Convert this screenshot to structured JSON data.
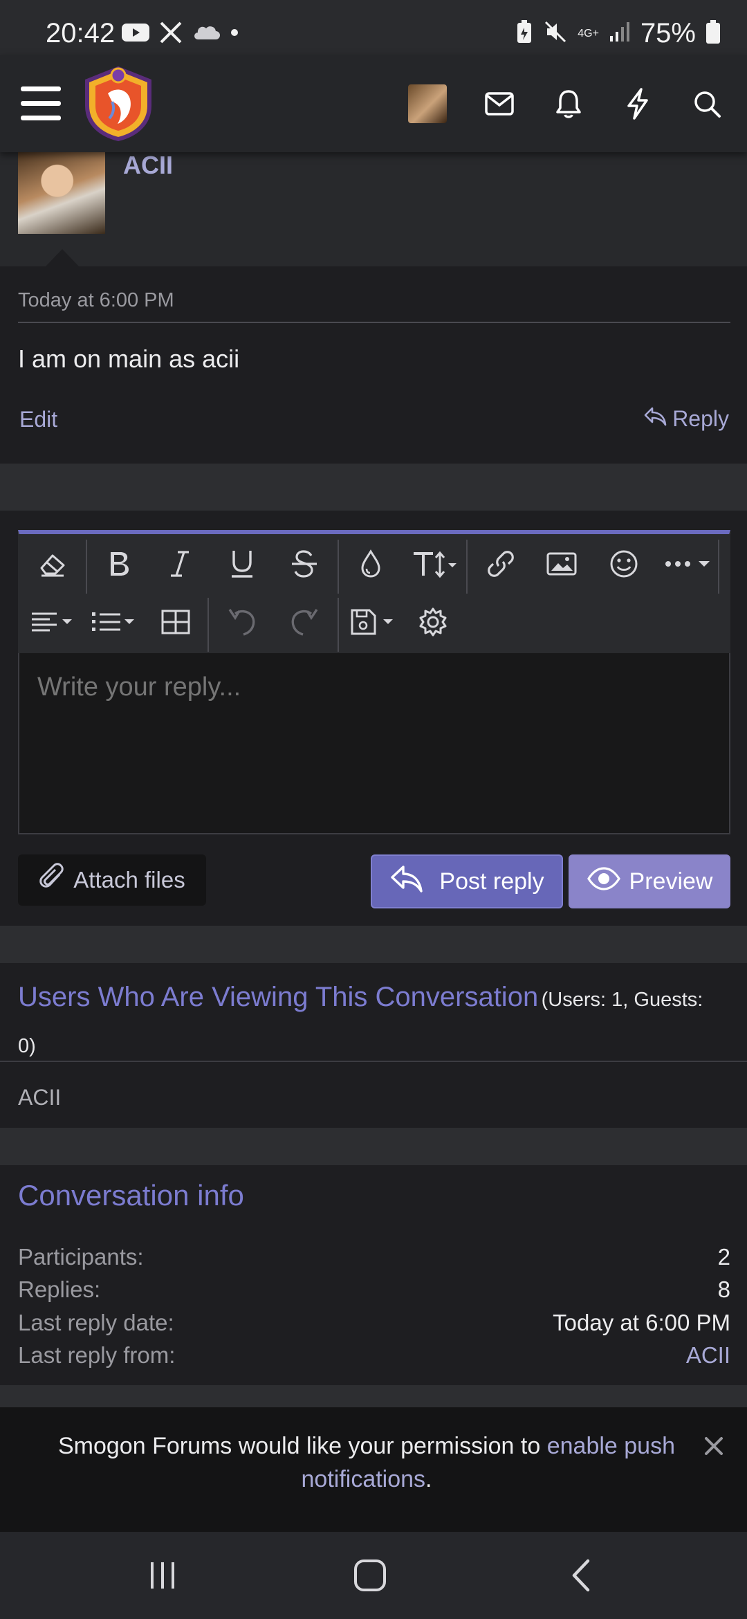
{
  "status_bar": {
    "time": "20:42",
    "battery": "75%",
    "network": "4G+",
    "icons": [
      "youtube-icon",
      "x-icon",
      "cloud-icon",
      "dot-icon",
      "battery-saver-icon",
      "mute-icon",
      "signal-icon",
      "battery-icon"
    ]
  },
  "header": {
    "icons": [
      "menu-icon",
      "site-logo",
      "user-avatar",
      "mail-icon",
      "bell-icon",
      "lightning-icon",
      "search-icon"
    ]
  },
  "post": {
    "author": "ACII",
    "date": "Today at 6:00 PM",
    "text": "I am on main as acii",
    "edit_label": "Edit",
    "reply_label": "Reply"
  },
  "editor": {
    "placeholder": "Write your reply...",
    "toolbar_row1": [
      "eraser-icon",
      "bold-icon",
      "italic-icon",
      "underline-icon",
      "strikethrough-icon",
      "color-drop-icon",
      "font-size-icon",
      "link-icon",
      "image-icon",
      "smiley-icon",
      "more-icon"
    ],
    "toolbar_row2": [
      "align-icon",
      "list-icon",
      "table-icon",
      "undo-icon",
      "redo-icon",
      "save-draft-icon",
      "settings-icon"
    ],
    "attach_label": "Attach files",
    "post_label": "Post reply",
    "preview_label": "Preview",
    "accent_color": "#6767b8"
  },
  "viewers": {
    "title": "Users Who Are Viewing This Conversation",
    "count": "(Users: 1, Guests: 0)",
    "users": [
      "ACII"
    ]
  },
  "conversation_info": {
    "title": "Conversation info",
    "rows": [
      {
        "label": "Participants:",
        "value": "2"
      },
      {
        "label": "Replies:",
        "value": "8"
      },
      {
        "label": "Last reply date:",
        "value": "Today at 6:00 PM"
      },
      {
        "label": "Last reply from:",
        "value": "ACII"
      }
    ]
  },
  "push_banner": {
    "text": "Smogon Forums would like your permission to ",
    "link": "enable push notifications",
    "suffix": "."
  },
  "nav": {
    "icons": [
      "recents-icon",
      "home-icon",
      "back-icon"
    ]
  }
}
